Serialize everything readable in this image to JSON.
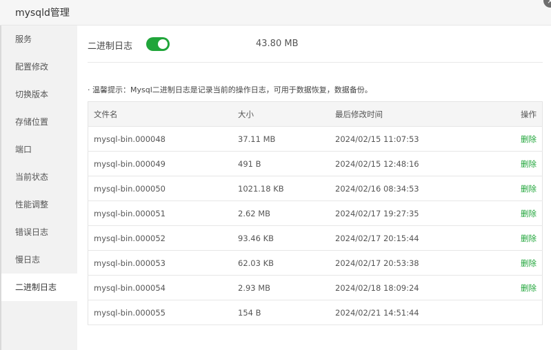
{
  "window": {
    "title": "mysqld管理",
    "close_icon": "×"
  },
  "sidebar": {
    "items": [
      {
        "label": "服务"
      },
      {
        "label": "配置修改"
      },
      {
        "label": "切换版本"
      },
      {
        "label": "存储位置"
      },
      {
        "label": "端口"
      },
      {
        "label": "当前状态"
      },
      {
        "label": "性能调整"
      },
      {
        "label": "错误日志"
      },
      {
        "label": "慢日志"
      },
      {
        "label": "二进制日志"
      }
    ],
    "active_index": 9
  },
  "binlog": {
    "label": "二进制日志",
    "enabled": true,
    "total_size": "43.80 MB",
    "toggle_color": "#20a53a"
  },
  "tip": "· 温馨提示：Mysql二进制日志是记录当前的操作日志，可用于数据恢复，数据备份。",
  "table": {
    "headers": [
      "文件名",
      "大小",
      "最后修改时间",
      "操作"
    ],
    "rows": [
      {
        "name": "mysql-bin.000048",
        "size": "37.11 MB",
        "mtime": "2024/02/15 11:07:53",
        "action": "删除"
      },
      {
        "name": "mysql-bin.000049",
        "size": "491 B",
        "mtime": "2024/02/15 12:48:16",
        "action": "删除"
      },
      {
        "name": "mysql-bin.000050",
        "size": "1021.18 KB",
        "mtime": "2024/02/16 08:34:53",
        "action": "删除"
      },
      {
        "name": "mysql-bin.000051",
        "size": "2.62 MB",
        "mtime": "2024/02/17 19:27:35",
        "action": "删除"
      },
      {
        "name": "mysql-bin.000052",
        "size": "93.46 KB",
        "mtime": "2024/02/17 20:15:44",
        "action": "删除"
      },
      {
        "name": "mysql-bin.000053",
        "size": "62.03 KB",
        "mtime": "2024/02/17 20:53:38",
        "action": "删除"
      },
      {
        "name": "mysql-bin.000054",
        "size": "2.93 MB",
        "mtime": "2024/02/18 18:09:24",
        "action": "删除"
      },
      {
        "name": "mysql-bin.000055",
        "size": "154 B",
        "mtime": "2024/02/21 14:51:44",
        "action": ""
      }
    ]
  }
}
